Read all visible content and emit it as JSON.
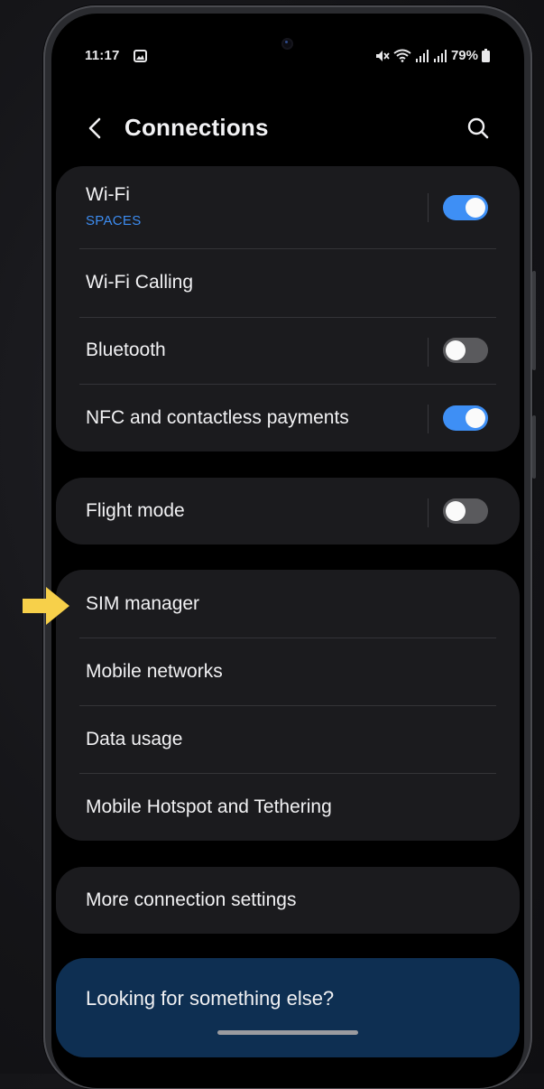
{
  "status_bar": {
    "time": "11:17",
    "battery": "79%",
    "icons": [
      "image-notification-icon",
      "mute-icon",
      "wifi-icon",
      "signal-icon",
      "signal-icon",
      "battery-icon"
    ]
  },
  "header": {
    "title": "Connections",
    "back_icon": "chevron-left-icon",
    "search_icon": "search-icon"
  },
  "groups": [
    {
      "items": [
        {
          "label": "Wi-Fi",
          "sub": "SPACES",
          "toggle": true
        },
        {
          "label": "Wi-Fi Calling"
        },
        {
          "label": "Bluetooth",
          "toggle": false
        },
        {
          "label": "NFC and contactless payments",
          "toggle": true
        }
      ]
    },
    {
      "items": [
        {
          "label": "Flight mode",
          "toggle": false
        }
      ]
    },
    {
      "items": [
        {
          "label": "SIM manager"
        },
        {
          "label": "Mobile networks"
        },
        {
          "label": "Data usage"
        },
        {
          "label": "Mobile Hotspot and Tethering"
        }
      ]
    },
    {
      "items": [
        {
          "label": "More connection settings"
        }
      ]
    }
  ],
  "footer": {
    "looking_label": "Looking for something else?"
  },
  "colors": {
    "accent": "#3e8ff5",
    "card": "#1b1b1e",
    "highlight_arrow": "#f7d04a",
    "footer_card": "#0e2f52"
  }
}
